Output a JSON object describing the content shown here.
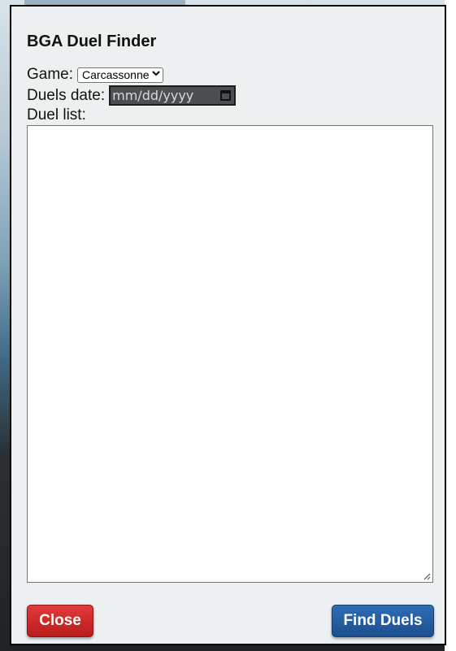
{
  "dialog": {
    "title": "BGA Duel Finder",
    "game_label": "Game:",
    "game_selected": "Carcassonne",
    "date_label": "Duels date:",
    "date_placeholder": "mm/dd/yyyy",
    "list_label": "Duel list:",
    "list_value": "",
    "close_label": "Close",
    "find_label": "Find Duels"
  },
  "colors": {
    "dialog_bg": "#edf0f1",
    "close_button": "#c62828",
    "find_button": "#245a9e"
  },
  "icons": {
    "select_arrow": "chevron-down-icon",
    "date_picker": "calendar-icon",
    "resize": "resize-grip-icon"
  }
}
